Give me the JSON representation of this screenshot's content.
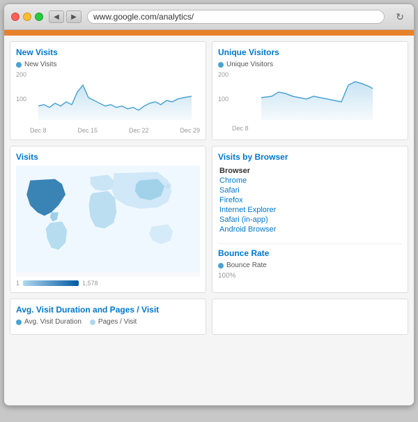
{
  "browser": {
    "url": "www.google.com/analytics/",
    "back_label": "◀",
    "forward_label": "▶",
    "reload_label": "↻"
  },
  "header": {
    "accent_color": "#e8812a"
  },
  "new_visits_card": {
    "title": "New Visits",
    "legend": "New Visits",
    "y_labels": [
      "200",
      "100"
    ],
    "x_labels": [
      "Dec 8",
      "Dec 15",
      "Dec 22",
      "Dec 29"
    ]
  },
  "unique_visitors_card": {
    "title": "Unique Visitors",
    "legend": "Unique Visitors",
    "y_labels": [
      "200",
      "100"
    ],
    "x_labels": [
      "Dec 8"
    ]
  },
  "visits_map_card": {
    "title": "Visits",
    "scale_min": "1",
    "scale_max": "1,578"
  },
  "visits_by_browser_card": {
    "title": "Visits by Browser",
    "column_header": "Browser",
    "browsers": [
      "Chrome",
      "Safari",
      "Firefox",
      "Internet Explorer",
      "Safari (in-app)",
      "Android Browser"
    ]
  },
  "bounce_rate_card": {
    "title": "Bounce Rate",
    "legend": "Bounce Rate",
    "y_label": "100%"
  },
  "avg_visit_card": {
    "title": "Avg. Visit Duration and Pages / Visit",
    "legend1": "Avg. Visit Duration",
    "legend2": "Pages / Visit"
  }
}
